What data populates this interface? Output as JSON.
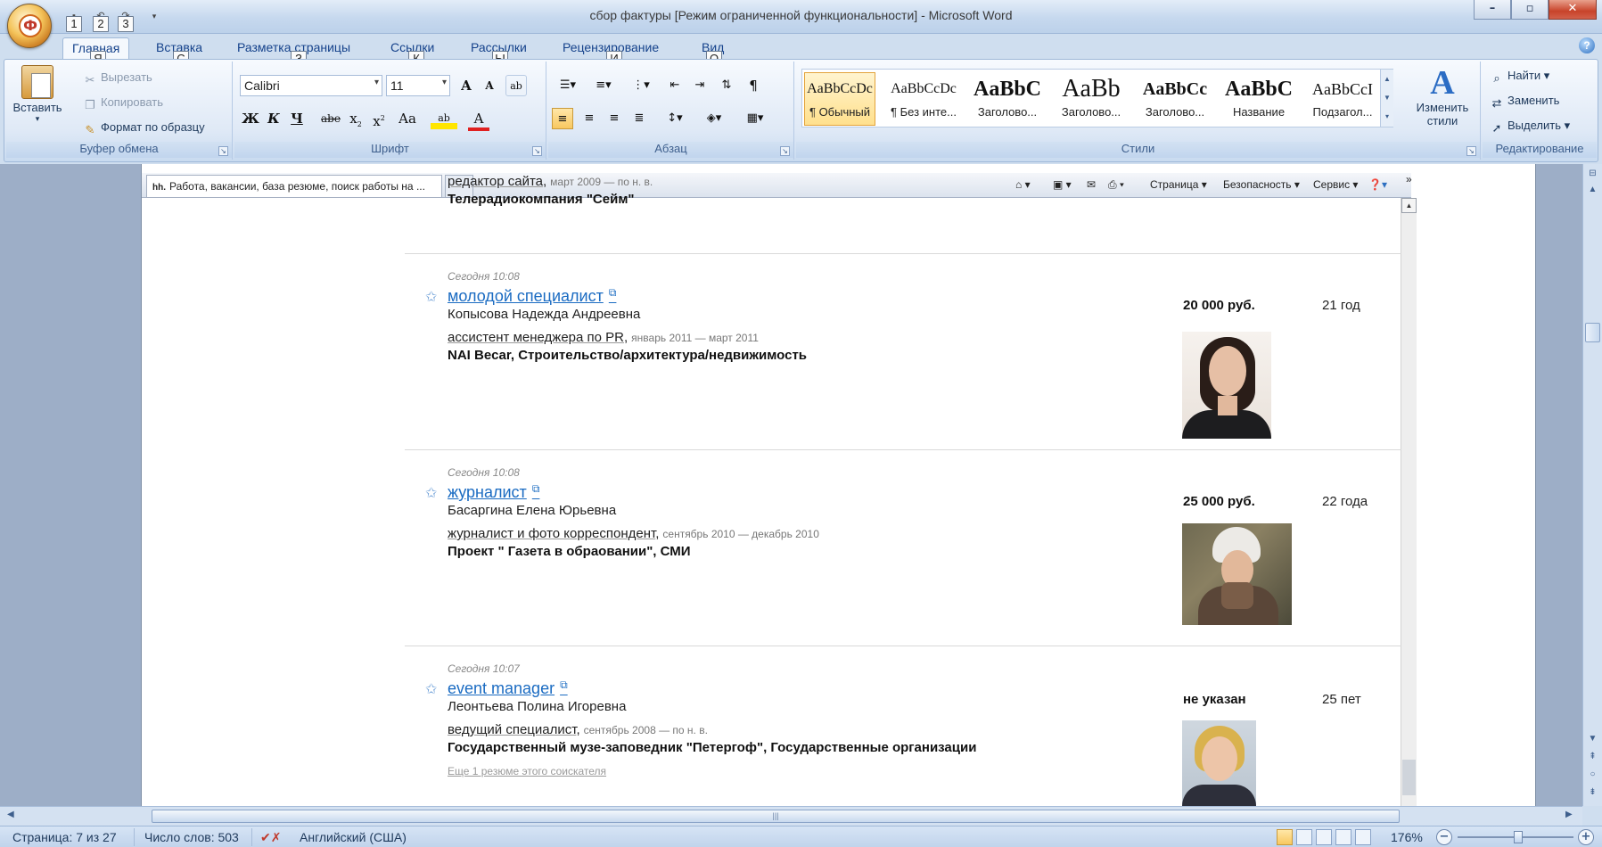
{
  "window": {
    "title": "сбор фактуры [Режим ограниченной функциональности] - Microsoft Word",
    "qat_keytips": [
      "1",
      "2",
      "3"
    ]
  },
  "ribbon_tabs": [
    {
      "label": "Главная",
      "keytip": "Я",
      "active": true
    },
    {
      "label": "Вставка",
      "keytip": "С"
    },
    {
      "label": "Разметка страницы",
      "keytip": "З"
    },
    {
      "label": "Ссылки",
      "keytip": "К"
    },
    {
      "label": "Рассылки",
      "keytip": "Ы"
    },
    {
      "label": "Рецензирование",
      "keytip": "И"
    },
    {
      "label": "Вид",
      "keytip": "О"
    }
  ],
  "clipboard": {
    "paste": "Вставить",
    "cut": "Вырезать",
    "copy": "Копировать",
    "format_painter": "Формат по образцу",
    "group_label": "Буфер обмена"
  },
  "font": {
    "family": "Calibri",
    "size": "11",
    "group_label": "Шрифт"
  },
  "paragraph": {
    "group_label": "Абзац"
  },
  "styles": {
    "items": [
      {
        "sample": "AaBbCcDc",
        "name": "¶ Обычный",
        "selected": true
      },
      {
        "sample": "AaBbCcDc",
        "name": "¶ Без инте..."
      },
      {
        "sample": "AaBbC",
        "name": "Заголово..."
      },
      {
        "sample": "AaBb",
        "name": "Заголово..."
      },
      {
        "sample": "AaBbCc",
        "name": "Заголово..."
      },
      {
        "sample": "AaBbC",
        "name": "Название"
      },
      {
        "sample": "AaBbCcI",
        "name": "Подзагол..."
      }
    ],
    "change_styles": "Изменить стили",
    "group_label": "Стили"
  },
  "editing": {
    "find": "Найти",
    "replace": "Заменить",
    "select": "Выделить",
    "group_label": "Редактирование"
  },
  "ie": {
    "tab_title": "Работа, вакансии, база резюме, поиск работы на ...",
    "tab_icon": "hh.",
    "page_menu": "Страница",
    "safety_menu": "Безопасность",
    "tools_menu": "Сервис"
  },
  "top_entry": {
    "position": "редактор сайта",
    "period": "март 2009 — по н. в.",
    "company": "Телерадиокомпания \"Сейм\""
  },
  "resumes": [
    {
      "date": "Сегодня 10:08",
      "title": "молодой специалист",
      "name": "Копысова Надежда Андреевна",
      "position": "ассистент менеджера по PR",
      "period": "январь 2011 — март 2011",
      "company": "NAI Becar, Строительство/архитектура/недвижимость",
      "salary": "20 000 руб.",
      "age": "21 год"
    },
    {
      "date": "Сегодня 10:08",
      "title": "журналист",
      "name": "Басаргина Елена Юрьевна",
      "position": "журналист и фото корреспондент",
      "period": "сентябрь 2010 — декабрь 2010",
      "company": "Проект \" Газета в обраовании\", СМИ",
      "salary": "25 000 руб.",
      "age": "22 года"
    },
    {
      "date": "Сегодня 10:07",
      "title": "event manager",
      "name": "Леонтьева Полина Игоревна",
      "position": "ведущий специалист",
      "period": "сентябрь 2008 — по н. в.",
      "company": "Государственный музе-заповедник \"Петергоф\", Государственные организации",
      "salary": "не указан",
      "age": "25 пет",
      "more": "Еще 1 резюме этого соискателя"
    }
  ],
  "status": {
    "page": "Страница: 7 из 27",
    "words": "Число слов: 503",
    "language": "Английский (США)",
    "zoom": "176%"
  },
  "colors": {
    "link": "#1a6bc2",
    "ribbon_text": "#15428b",
    "ribbon_bg": "#dfe9f6"
  }
}
